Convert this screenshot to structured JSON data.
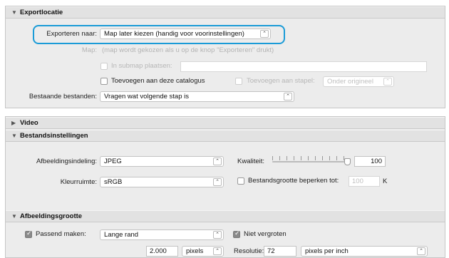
{
  "export_location": {
    "title": "Exportlocatie",
    "export_to_label": "Exporteren naar:",
    "export_to_value": "Map later kiezen (handig voor voorinstellingen)",
    "map_label": "Map:",
    "map_value": "(map wordt gekozen als u op de knop \"Exporteren\" drukt)",
    "subfolder_label": "In submap plaatsen:",
    "subfolder_value": "",
    "add_catalog_label": "Toevoegen aan deze catalogus",
    "add_stack_label": "Toevoegen aan stapel:",
    "stack_position_value": "Onder origineel",
    "existing_files_label": "Bestaande bestanden:",
    "existing_files_value": "Vragen wat volgende stap is"
  },
  "video": {
    "title": "Video"
  },
  "file_settings": {
    "title": "Bestandsinstellingen",
    "format_label": "Afbeeldingsindeling:",
    "format_value": "JPEG",
    "quality_label": "Kwaliteit:",
    "quality_value": "100",
    "quality_level": 1.0,
    "colorspace_label": "Kleurruimte:",
    "colorspace_value": "sRGB",
    "limit_size_label": "Bestandsgrootte beperken tot:",
    "limit_size_value": "100",
    "limit_size_unit": "K"
  },
  "image_sizing": {
    "title": "Afbeeldingsgrootte",
    "fit_label": "Passend maken:",
    "fit_value": "Lange rand",
    "no_enlarge_label": "Niet vergroten",
    "size_value": "2.000",
    "size_unit": "pixels",
    "resolution_label": "Resolutie:",
    "resolution_value": "72",
    "resolution_unit": "pixels per inch"
  },
  "colors": {
    "highlight": "#1a9bd7",
    "panel": "#ececec",
    "header": "#e2e2e2"
  },
  "icons": {
    "collapse": "triangle-down-icon",
    "expand": "triangle-right-icon",
    "dropdown": "chevron-updown-icon",
    "check": "checkmark-icon"
  }
}
